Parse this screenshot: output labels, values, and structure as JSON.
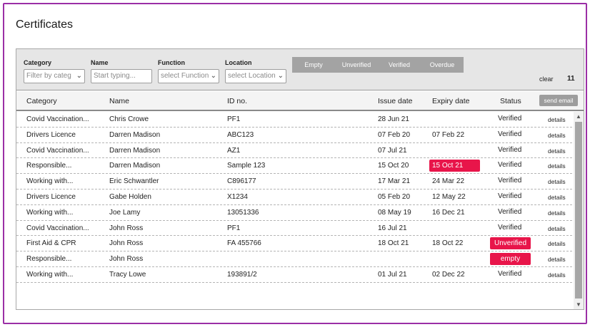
{
  "page": {
    "title": "Certificates"
  },
  "filters": {
    "category": {
      "label": "Category",
      "placeholder": "Filter by categ"
    },
    "name": {
      "label": "Name",
      "placeholder": "Start typing..."
    },
    "function": {
      "label": "Function",
      "placeholder": "select Function"
    },
    "location": {
      "label": "Location",
      "placeholder": "select Location"
    },
    "status_buttons": [
      "Empty",
      "Unverified",
      "Verified",
      "Overdue"
    ],
    "clear_label": "clear",
    "result_count": "11"
  },
  "table": {
    "headers": {
      "category": "Category",
      "name": "Name",
      "id": "ID no.",
      "issue": "Issue date",
      "expiry": "Expiry date",
      "status": "Status"
    },
    "send_email_label": "send email",
    "details_label": "details",
    "colors": {
      "alert": "#e8154a",
      "filter_bar": "#a3a3a3",
      "frame": "#9b2fa6"
    },
    "rows": [
      {
        "category": "Covid Vaccination...",
        "name": "Chris Crowe",
        "id": "PF1",
        "issue": "28 Jun 21",
        "expiry": "",
        "expiry_alert": false,
        "status": "Verified",
        "status_alert": false
      },
      {
        "category": "Drivers Licence",
        "name": "Darren Madison",
        "id": "ABC123",
        "issue": "07 Feb 20",
        "expiry": "07 Feb 22",
        "expiry_alert": false,
        "status": "Verified",
        "status_alert": false
      },
      {
        "category": "Covid Vaccination...",
        "name": "Darren Madison",
        "id": "AZ1",
        "issue": "07 Jul 21",
        "expiry": "",
        "expiry_alert": false,
        "status": "Verified",
        "status_alert": false
      },
      {
        "category": "Responsible...",
        "name": "Darren Madison",
        "id": "Sample 123",
        "issue": "15 Oct 20",
        "expiry": "15 Oct 21",
        "expiry_alert": true,
        "status": "Verified",
        "status_alert": false
      },
      {
        "category": "Working with...",
        "name": "Eric Schwantler",
        "id": "C896177",
        "issue": "17 Mar 21",
        "expiry": "24 Mar 22",
        "expiry_alert": false,
        "status": "Verified",
        "status_alert": false
      },
      {
        "category": "Drivers Licence",
        "name": "Gabe Holden",
        "id": "X1234",
        "issue": "05 Feb 20",
        "expiry": "12 May 22",
        "expiry_alert": false,
        "status": "Verified",
        "status_alert": false
      },
      {
        "category": "Working with...",
        "name": "Joe Lamy",
        "id": "13051336",
        "issue": "08 May 19",
        "expiry": "16 Dec 21",
        "expiry_alert": false,
        "status": "Verified",
        "status_alert": false
      },
      {
        "category": "Covid Vaccination...",
        "name": "John Ross",
        "id": "PF1",
        "issue": "16 Jul 21",
        "expiry": "",
        "expiry_alert": false,
        "status": "Verified",
        "status_alert": false
      },
      {
        "category": "First Aid & CPR",
        "name": "John Ross",
        "id": "FA 455766",
        "issue": "18 Oct 21",
        "expiry": "18 Oct 22",
        "expiry_alert": false,
        "status": "Unverified",
        "status_alert": true
      },
      {
        "category": "Responsible...",
        "name": "John Ross",
        "id": "",
        "issue": "",
        "expiry": "",
        "expiry_alert": false,
        "status": "empty",
        "status_alert": true
      },
      {
        "category": "Working with...",
        "name": "Tracy Lowe",
        "id": "193891/2",
        "issue": "01 Jul 21",
        "expiry": "02 Dec 22",
        "expiry_alert": false,
        "status": "Verified",
        "status_alert": false
      }
    ]
  }
}
